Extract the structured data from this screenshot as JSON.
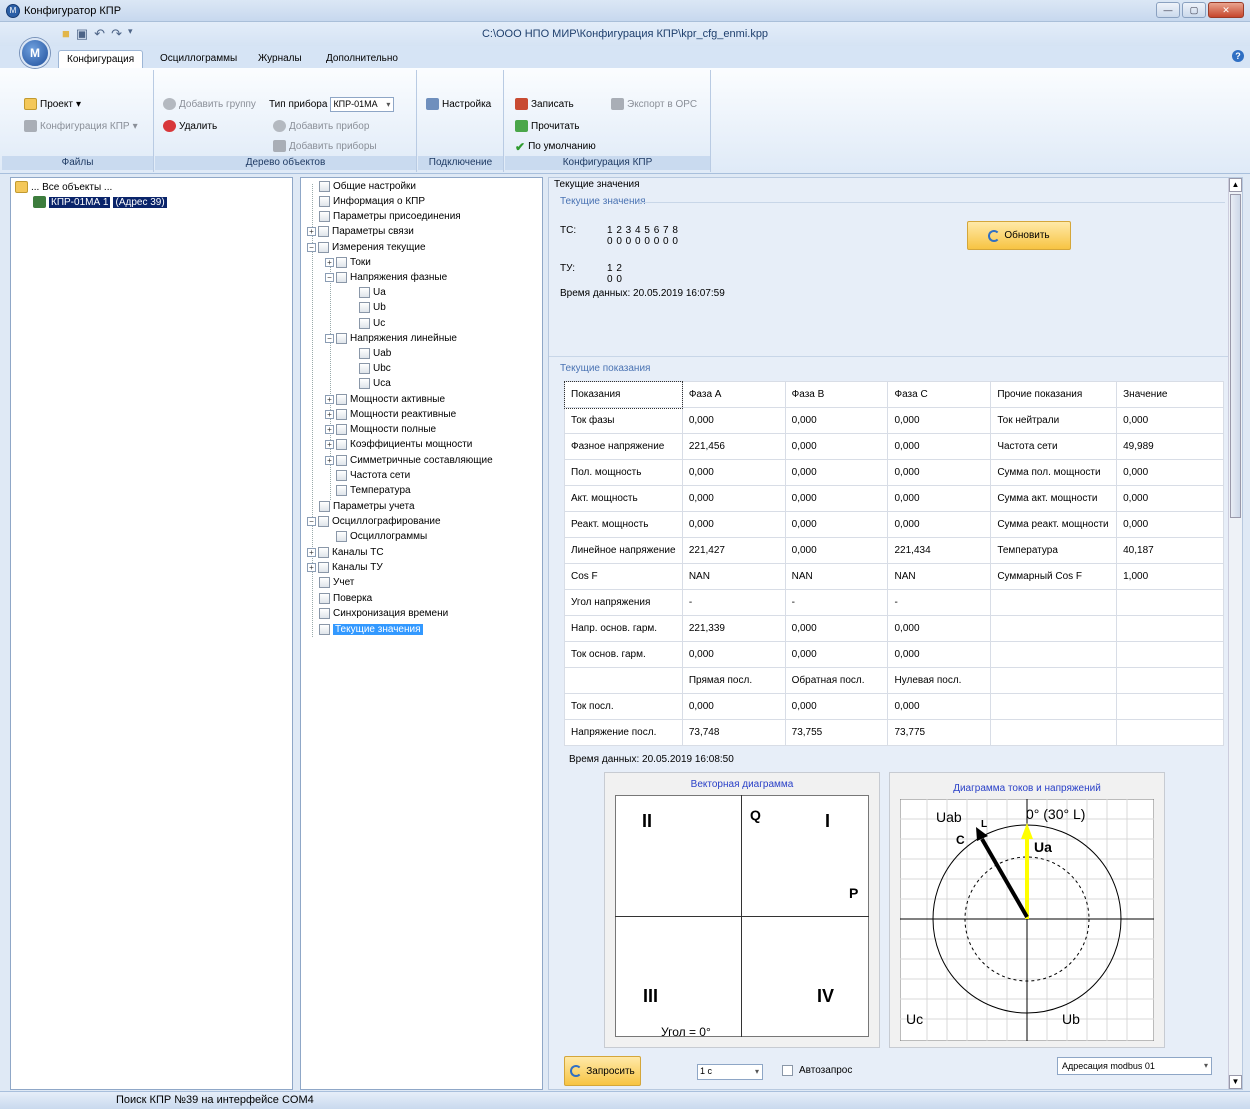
{
  "window": {
    "title": "Конфигуратор КПР",
    "filepath": "C:\\ООО НПО МИР\\Конфигурация КПР\\kpr_cfg_enmi.kpp",
    "logo": "М"
  },
  "tabs": [
    "Конфигурация",
    "Осциллограммы",
    "Журналы",
    "Дополнительно"
  ],
  "ribbon": {
    "files": {
      "label": "Файлы",
      "project": "Проект",
      "config": "Конфигурация КПР"
    },
    "tree": {
      "label": "Дерево объектов",
      "add_group": "Добавить группу",
      "delete": "Удалить",
      "device_type_label": "Тип прибора",
      "device_type_value": "КПР-01МА",
      "add_device": "Добавить прибор",
      "add_devices": "Добавить приборы"
    },
    "connection": {
      "label": "Подключение",
      "settings": "Настройка"
    },
    "kpr": {
      "label": "Конфигурация КПР",
      "write": "Записать",
      "read": "Прочитать",
      "default": "По умолчанию",
      "export": "Экспорт в OPC"
    }
  },
  "objects": {
    "root": "... Все объекты ...",
    "device": "КПР-01МА 1",
    "address": "(Адрес 39)"
  },
  "config_tree": [
    "Общие настройки",
    "Информация о КПР",
    "Параметры присоединения",
    "Параметры связи",
    "Измерения текущие",
    "Токи",
    "Напряжения фазные",
    "Ua",
    "Ub",
    "Uc",
    "Напряжения линейные",
    "Uab",
    "Ubc",
    "Uca",
    "Мощности активные",
    "Мощности реактивные",
    "Мощности полные",
    "Коэффициенты мощности",
    "Симметричные составляющие",
    "Частота сети",
    "Температура",
    "Параметры учета",
    "Осциллографирование",
    "Осциллограммы",
    "Каналы ТС",
    "Каналы ТУ",
    "Учет",
    "Поверка",
    "Синхронизация времени",
    "Текущие значения"
  ],
  "current": {
    "header": "Текущие значения",
    "section1": "Текущие значения",
    "ts_label": "ТС:",
    "ts_idx": "1 2 3 4 5 6 7 8",
    "ts_val": "0 0 0 0 0 0 0 0",
    "tu_label": "ТУ:",
    "tu_idx": "1 2",
    "tu_val": "0 0",
    "time1": "Время данных: 20.05.2019 16:07:59",
    "refresh": "Обновить",
    "section2": "Текущие показания",
    "time2": "Время данных: 20.05.2019 16:08:50"
  },
  "table": [
    [
      "Показания",
      "Фаза А",
      "Фаза В",
      "Фаза С",
      "Прочие показания",
      "Значение"
    ],
    [
      "Ток фазы",
      "0,000",
      "0,000",
      "0,000",
      "Ток нейтрали",
      "0,000"
    ],
    [
      "Фазное напряжение",
      "221,456",
      "0,000",
      "0,000",
      "Частота сети",
      "49,989"
    ],
    [
      "Пол. мощность",
      "0,000",
      "0,000",
      "0,000",
      "Сумма пол. мощности",
      "0,000"
    ],
    [
      "Акт. мощность",
      "0,000",
      "0,000",
      "0,000",
      "Сумма акт. мощности",
      "0,000"
    ],
    [
      "Реакт. мощность",
      "0,000",
      "0,000",
      "0,000",
      "Сумма реакт. мощности",
      "0,000"
    ],
    [
      "Линейное напряжение",
      "221,427",
      "0,000",
      "221,434",
      "Температура",
      "40,187"
    ],
    [
      "Cos F",
      "NAN",
      "NAN",
      "NAN",
      "Суммарный Cos F",
      "1,000"
    ],
    [
      "Угол напряжения",
      "-",
      "-",
      "-",
      "",
      ""
    ],
    [
      "Напр. основ. гарм.",
      "221,339",
      "0,000",
      "0,000",
      "",
      ""
    ],
    [
      "Ток основ. гарм.",
      "0,000",
      "0,000",
      "0,000",
      "",
      ""
    ],
    [
      "",
      "Прямая посл.",
      "Обратная посл.",
      "Нулевая посл.",
      "",
      ""
    ],
    [
      "Ток посл.",
      "0,000",
      "0,000",
      "0,000",
      "",
      ""
    ],
    [
      "Напряжение посл.",
      "73,748",
      "73,755",
      "73,775",
      "",
      ""
    ]
  ],
  "vector": {
    "title": "Векторная диаграмма",
    "q1": "I",
    "q2": "II",
    "q3": "III",
    "q4": "IV",
    "axis_q": "Q",
    "axis_p": "P",
    "angle": "Угол = 0°"
  },
  "phasor": {
    "title": "Диаграмма токов и напряжений",
    "uab": "Uab",
    "ua": "Ua",
    "ub": "Ub",
    "uc": "Uc",
    "ref": "0° (30° L)",
    "c": "C",
    "l": "L",
    "colors": {
      "ua": "#ffff00",
      "uab": "#000000"
    }
  },
  "bottom": {
    "request": "Запросить",
    "interval": "1 с",
    "auto": "Автозапрос",
    "addressing": "Адресация modbus 01"
  },
  "status": "Поиск КПР №39 на интерфейсе COM4"
}
